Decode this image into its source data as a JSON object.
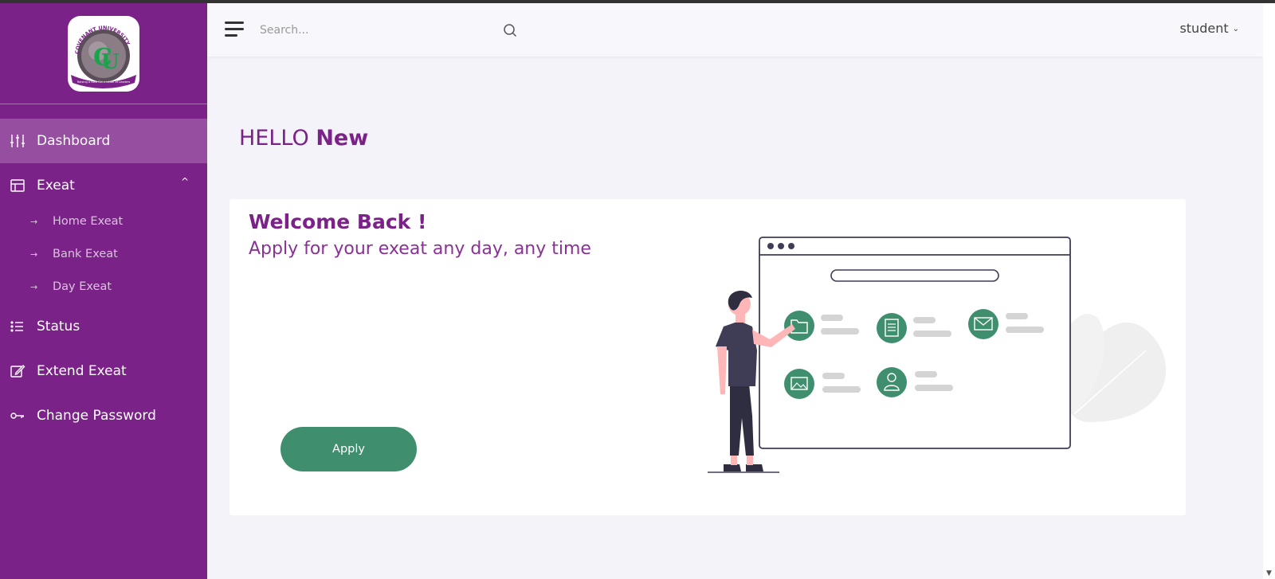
{
  "sidebar": {
    "logo_text": "COVENANT UNIVERSITY",
    "logo_motto": "Raising a New Generation of Leaders",
    "items": [
      {
        "label": "Dashboard",
        "icon": "sliders-icon"
      },
      {
        "label": "Exeat",
        "icon": "layout-icon"
      },
      {
        "label": "Status",
        "icon": "list-icon"
      },
      {
        "label": "Extend Exeat",
        "icon": "edit-icon"
      },
      {
        "label": "Change Password",
        "icon": "key-icon"
      }
    ],
    "sub_items": [
      {
        "label": "Home Exeat"
      },
      {
        "label": "Bank Exeat"
      },
      {
        "label": "Day Exeat"
      }
    ],
    "sub_arrow": "→",
    "chevron": "^"
  },
  "topbar": {
    "search_placeholder": "Search...",
    "user_label": "student",
    "user_caret": "⌄"
  },
  "main": {
    "greeting_prefix": "HELLO ",
    "greeting_name": "New",
    "card": {
      "title": "Welcome Back !",
      "subtitle": "Apply for your exeat any day, any time",
      "apply_label": "Apply"
    }
  },
  "colors": {
    "brand": "#7b2289",
    "accent": "#3f8f6f",
    "background": "#f4f3f9"
  }
}
